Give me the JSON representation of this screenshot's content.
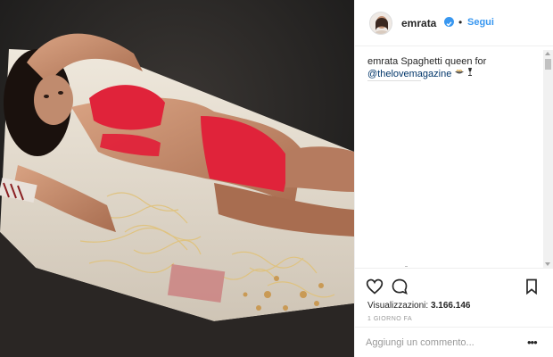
{
  "post": {
    "image_alt_colors": {
      "background": "#1b1b1b",
      "table": "#e8e0d4",
      "lingerie": "#e0233a",
      "skin": "#c98f72"
    }
  },
  "header": {
    "username": "emrata",
    "separator": "•",
    "follow_label": "Segui"
  },
  "caption": {
    "author": "emrata",
    "text": "Spaghetti queen for",
    "mention": "@thelovemagazine"
  },
  "stats": {
    "views_label": "Visualizzazioni:",
    "views_count": "3.166.146",
    "date": "1 GIORNO FA"
  },
  "comment": {
    "placeholder": "Aggiungi un commento..."
  },
  "icons": {
    "like": "heart-icon",
    "comment": "speech-bubble-icon",
    "save": "bookmark-icon",
    "more": "ellipsis-icon"
  },
  "colors": {
    "link": "#3897f0",
    "mention": "#003569",
    "muted": "#999999",
    "text": "#262626"
  }
}
